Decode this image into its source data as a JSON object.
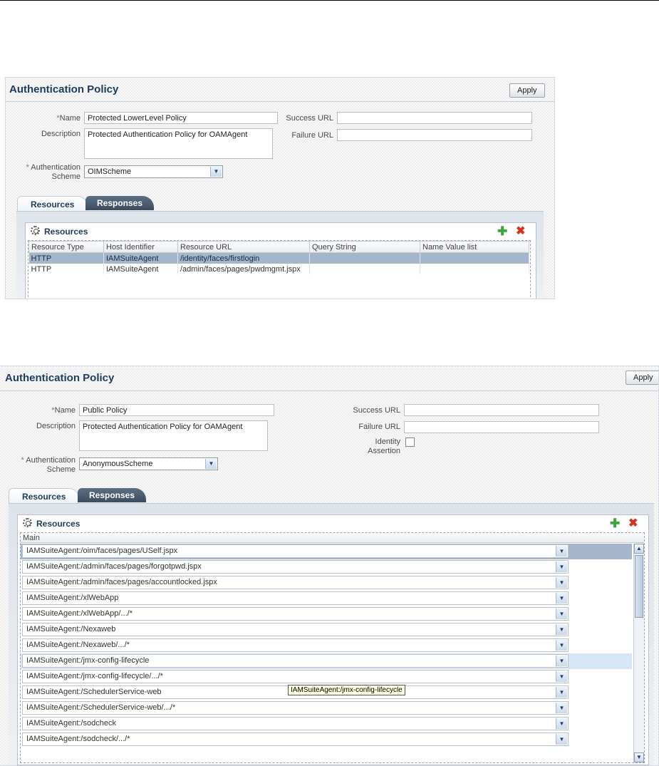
{
  "panel1": {
    "title": "Authentication Policy",
    "apply_label": "Apply",
    "name_label": "Name",
    "name_value": "Protected LowerLevel Policy",
    "description_label": "Description",
    "description_value": "Protected Authentication Policy for OAMAgent",
    "success_url_label": "Success URL",
    "success_url_value": "",
    "failure_url_label": "Failure URL",
    "failure_url_value": "",
    "auth_scheme_label_1": "Authentication",
    "auth_scheme_label_2": "Scheme",
    "auth_scheme_value": "OIMScheme",
    "tabs": [
      "Resources",
      "Responses"
    ],
    "resources_title": "Resources",
    "table_headers": [
      "Resource Type",
      "Host Identifier",
      "Resource URL",
      "Query String",
      "Name Value list"
    ],
    "table_rows": [
      [
        "HTTP",
        "IAMSuiteAgent",
        "/identity/faces/firstlogin",
        "",
        ""
      ],
      [
        "HTTP",
        "IAMSuiteAgent",
        "/admin/faces/pages/pwdmgmt.jspx",
        "",
        ""
      ]
    ]
  },
  "panel2": {
    "title": "Authentication Policy",
    "apply_label": "Apply",
    "name_label": "Name",
    "name_value": "Public Policy",
    "description_label": "Description",
    "description_value": "Protected Authentication Policy for OAMAgent",
    "success_url_label": "Success URL",
    "success_url_value": "",
    "failure_url_label": "Failure URL",
    "failure_url_value": "",
    "identity_assertion_label_1": "Identity",
    "identity_assertion_label_2": "Assertion",
    "identity_assertion_checked": false,
    "auth_scheme_label_1": "Authentication",
    "auth_scheme_label_2": "Scheme",
    "auth_scheme_value": "AnonymousScheme",
    "tabs": [
      "Resources",
      "Responses"
    ],
    "resources_title": "Resources",
    "column_header": "Main",
    "rows": [
      "IAMSuiteAgent:/oim/faces/pages/USelf.jspx",
      "IAMSuiteAgent:/admin/faces/pages/forgotpwd.jspx",
      "IAMSuiteAgent:/admin/faces/pages/accountlocked.jspx",
      "IAMSuiteAgent:/xlWebApp",
      "IAMSuiteAgent:/xlWebApp/.../*",
      "IAMSuiteAgent:/Nexaweb",
      "IAMSuiteAgent:/Nexaweb/.../*",
      "IAMSuiteAgent:/jmx-config-lifecycle",
      "IAMSuiteAgent:/jmx-config-lifecycle/.../*",
      "IAMSuiteAgent:/SchedulerService-web",
      "IAMSuiteAgent:/SchedulerService-web/.../*",
      "IAMSuiteAgent:/sodcheck",
      "IAMSuiteAgent:/sodcheck/.../*"
    ],
    "tooltip": "IAMSuiteAgent:/jmx-config-lifecycle"
  },
  "icons": {
    "add": "plus-icon",
    "delete": "x-icon",
    "resources": "gear-icon",
    "dropdown": "chevron-down-icon"
  },
  "colors": {
    "title": "#1f3c5e",
    "selected_row": "#a5b6cc",
    "hover_row": "#d6e6f6",
    "add_icon": "#3aa53a",
    "delete_icon": "#d8311e"
  }
}
